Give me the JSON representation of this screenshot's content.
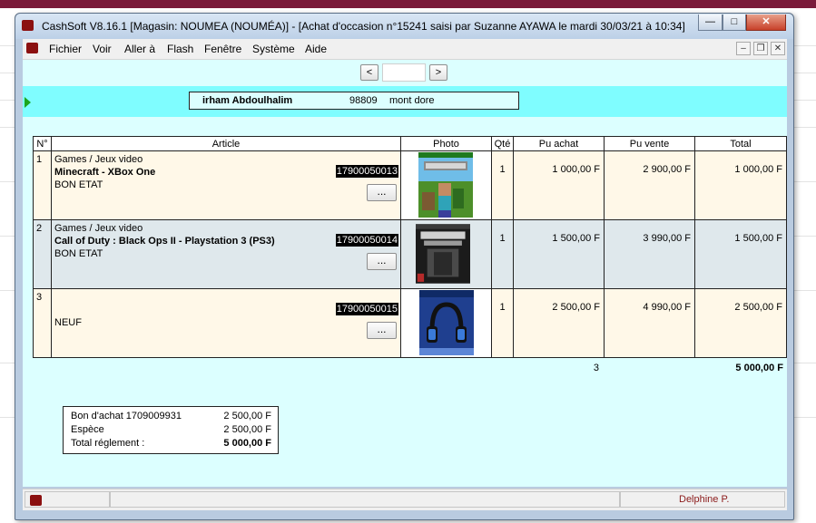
{
  "window": {
    "title": "CashSoft V8.16.1 [Magasin: NOUMEA (NOUMÉA)] - [Achat d'occasion n°15241 saisi par Suzanne AYAWA le mardi 30/03/21 à 10:34]",
    "minimize_glyph": "—",
    "maximize_glyph": "□",
    "close_glyph": "✕"
  },
  "menu": {
    "items": [
      "Fichier",
      "Voir",
      "Aller à",
      "Flash",
      "Fenêtre",
      "Système",
      "Aide"
    ],
    "mdi_minimize": "–",
    "mdi_restore": "❐",
    "mdi_close": "✕"
  },
  "nav": {
    "prev": "<",
    "next": ">",
    "record_value": ""
  },
  "customer": {
    "name": "irham Abdoulhalim",
    "postcode": "98809",
    "city": "mont dore"
  },
  "table": {
    "headers": [
      "N°",
      "Article",
      "Photo",
      "Qté",
      "Pu achat",
      "Pu vente",
      "Total"
    ],
    "rows": [
      {
        "index": "1",
        "category": "Games / Jeux video",
        "title": "Minecraft - XBox One",
        "condition": "BON ETAT",
        "barcode": "17900050013",
        "button": "...",
        "qty": "1",
        "pu_achat": "1 000,00 F",
        "pu_vente": "2 900,00 F",
        "total": "1 000,00 F",
        "cover": "minecraft-cover"
      },
      {
        "index": "2",
        "category": "Games / Jeux video",
        "title": "Call of Duty : Black Ops II - Playstation 3 (PS3)",
        "condition": "BON ETAT",
        "barcode": "17900050014",
        "button": "...",
        "qty": "1",
        "pu_achat": "1 500,00 F",
        "pu_vente": "3 990,00 F",
        "total": "1 500,00 F",
        "cover": "black-ops-cover"
      },
      {
        "index": "3",
        "category": "",
        "title": "",
        "condition": "NEUF",
        "barcode": "17900050015",
        "button": "...",
        "qty": "1",
        "pu_achat": "2 500,00 F",
        "pu_vente": "4 990,00 F",
        "total": "2 500,00 F",
        "cover": "headset-box"
      }
    ],
    "total_qty": "3",
    "grand_total": "5 000,00 F"
  },
  "payment": {
    "lines": [
      {
        "label": "Bon d'achat 1709009931",
        "value": "2 500,00 F"
      },
      {
        "label": "Espèce",
        "value": "2 500,00 F"
      },
      {
        "label": "Total réglement :",
        "value": "5 000,00 F"
      }
    ]
  },
  "status": {
    "user": "Delphine P.",
    "user_color": "#8b1a1a"
  },
  "colors": {
    "content_bg": "#dcffff",
    "customer_band": "#7ffdff",
    "row_odd": "#fff8e8",
    "row_even": "#dfe8ec",
    "accent_icon": "#8b1010"
  },
  "icons": [
    "app-logo-icon",
    "green-arrow-icon",
    "status-logo-icon"
  ]
}
